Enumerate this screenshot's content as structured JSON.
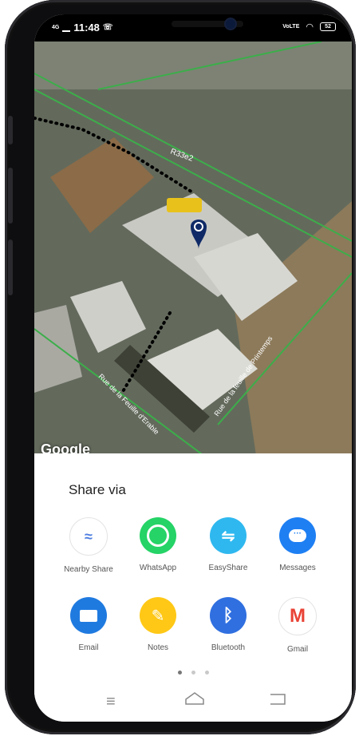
{
  "status": {
    "network": "4G",
    "time": "11:48",
    "battery": "52"
  },
  "map": {
    "watermark": "Google",
    "road_labels": [
      "R33e2",
      "Rue de la Feuille d'Erable",
      "Rue de la feuille de Printemps"
    ]
  },
  "share": {
    "title": "Share via",
    "apps": [
      {
        "label": "Nearby Share",
        "icon": "nearby-share-icon"
      },
      {
        "label": "WhatsApp",
        "icon": "whatsapp-icon"
      },
      {
        "label": "EasyShare",
        "icon": "easyshare-icon"
      },
      {
        "label": "Messages",
        "icon": "messages-icon"
      },
      {
        "label": "Email",
        "icon": "email-icon"
      },
      {
        "label": "Notes",
        "icon": "notes-icon"
      },
      {
        "label": "Bluetooth",
        "icon": "bluetooth-icon"
      },
      {
        "label": "Gmail",
        "icon": "gmail-icon"
      }
    ],
    "page_count": 3,
    "active_page": 1
  },
  "colors": {
    "whatsapp": "#25d366",
    "easyshare": "#2fb8ef",
    "messages": "#1e7ff3",
    "email": "#1f7ae0",
    "notes": "#ffc816",
    "bluetooth": "#2f6fe0",
    "route": "#000000",
    "roads": "#3cae4a"
  }
}
